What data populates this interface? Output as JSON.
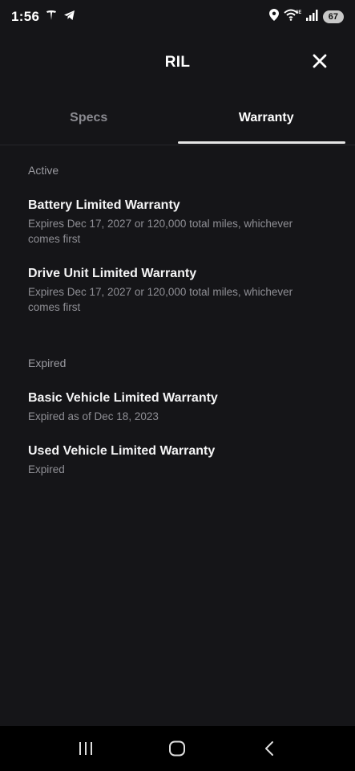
{
  "status_bar": {
    "time": "1:56",
    "battery": "67",
    "signal_label": "6E"
  },
  "header": {
    "title": "RIL"
  },
  "tabs": [
    {
      "label": "Specs",
      "active": false
    },
    {
      "label": "Warranty",
      "active": true
    }
  ],
  "sections": {
    "active": {
      "label": "Active",
      "items": [
        {
          "title": "Battery Limited Warranty",
          "subtitle": "Expires Dec 17, 2027 or 120,000 total miles, whichever comes first"
        },
        {
          "title": "Drive Unit Limited Warranty",
          "subtitle": "Expires Dec 17, 2027 or 120,000 total miles, whichever comes first"
        }
      ]
    },
    "expired": {
      "label": "Expired",
      "items": [
        {
          "title": "Basic Vehicle Limited Warranty",
          "subtitle": "Expired as of Dec 18, 2023"
        },
        {
          "title": "Used Vehicle Limited Warranty",
          "subtitle": "Expired"
        }
      ]
    }
  },
  "icons": {
    "close": "close-icon",
    "recent_apps": "recent-apps-icon",
    "home": "home-icon",
    "back": "back-icon"
  }
}
